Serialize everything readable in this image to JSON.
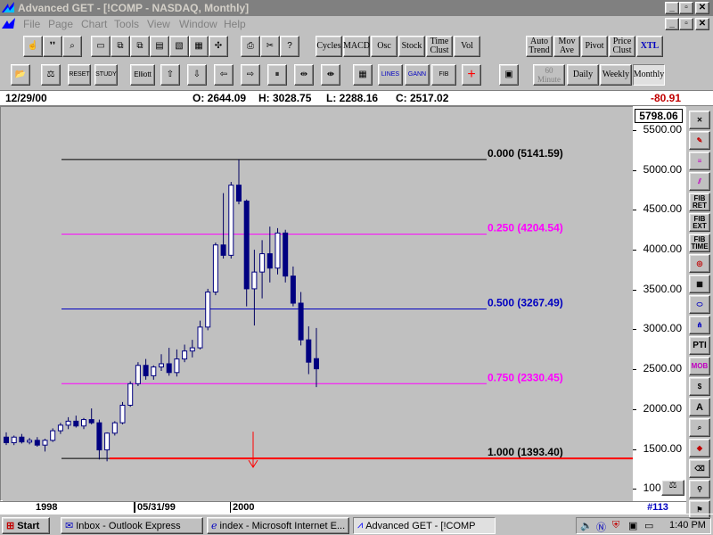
{
  "window": {
    "title": "Advanced GET - [!COMP   - NASDAQ, Monthly]",
    "controls": [
      "_",
      "▫",
      "✕"
    ],
    "child_controls": [
      "_",
      "▫",
      "✕"
    ]
  },
  "menu": [
    "File",
    "Page",
    "Chart",
    "Tools",
    "View",
    "Window",
    "Help"
  ],
  "toolbar1": {
    "text_buttons": [
      "Cycles",
      "MACD",
      "Osc",
      "Stock",
      "Time Clust",
      "Vol"
    ],
    "right_buttons": [
      "Auto Trend",
      "Mov Ave",
      "Pivot",
      "Price Clust",
      "XTL"
    ]
  },
  "toolbar2": {
    "labeled_buttons": [
      "RESET",
      "STUDY",
      "Elliott",
      "LINES",
      "GANN",
      "FIB"
    ],
    "timeframes": [
      "60 Minute",
      "Daily",
      "Weekly",
      "Monthly"
    ],
    "active_timeframe": "Monthly"
  },
  "info": {
    "date": "12/29/00",
    "open": "O: 2644.09",
    "high": "H: 3028.75",
    "low": "L: 2288.16",
    "close": "C: 2517.02",
    "change": "-80.91"
  },
  "current_price": "5798.06",
  "price_axis": [
    "5500.00",
    "5000.00",
    "4500.00",
    "4000.00",
    "3500.00",
    "3000.00",
    "2500.00",
    "2000.00",
    "1500.00",
    "1000.00"
  ],
  "date_axis": [
    "1998",
    "05/31/99",
    "2000"
  ],
  "chart_data": {
    "type": "candlestick",
    "ylim": [
      880,
      5800
    ],
    "fib_levels": [
      {
        "ratio": "0.000",
        "price": "5141.59",
        "label": "0.000 (5141.59)",
        "color": "#000000"
      },
      {
        "ratio": "0.250",
        "price": "4204.54",
        "label": "0.250 (4204.54)",
        "color": "#ff00ff"
      },
      {
        "ratio": "0.500",
        "price": "3267.49",
        "label": "0.500 (3267.49)",
        "color": "#0000c0"
      },
      {
        "ratio": "0.750",
        "price": "2330.45",
        "label": "0.750 (2330.45)",
        "color": "#ff00ff"
      },
      {
        "ratio": "1.000",
        "price": "1393.40",
        "label": "1.000 (1393.40)",
        "color": "#000000"
      }
    ],
    "support_line": 1393.4,
    "candles": [
      {
        "o": 1660,
        "h": 1720,
        "l": 1560,
        "c": 1590
      },
      {
        "o": 1590,
        "h": 1680,
        "l": 1560,
        "c": 1660
      },
      {
        "o": 1660,
        "h": 1700,
        "l": 1580,
        "c": 1600
      },
      {
        "o": 1600,
        "h": 1650,
        "l": 1570,
        "c": 1620
      },
      {
        "o": 1620,
        "h": 1660,
        "l": 1540,
        "c": 1560
      },
      {
        "o": 1560,
        "h": 1640,
        "l": 1480,
        "c": 1620
      },
      {
        "o": 1620,
        "h": 1770,
        "l": 1600,
        "c": 1740
      },
      {
        "o": 1740,
        "h": 1840,
        "l": 1700,
        "c": 1810
      },
      {
        "o": 1810,
        "h": 1910,
        "l": 1760,
        "c": 1860
      },
      {
        "o": 1860,
        "h": 1930,
        "l": 1780,
        "c": 1800
      },
      {
        "o": 1800,
        "h": 1900,
        "l": 1760,
        "c": 1880
      },
      {
        "o": 1880,
        "h": 2020,
        "l": 1820,
        "c": 1840
      },
      {
        "o": 1840,
        "h": 1880,
        "l": 1380,
        "c": 1500
      },
      {
        "o": 1500,
        "h": 1720,
        "l": 1357,
        "c": 1710
      },
      {
        "o": 1710,
        "h": 1860,
        "l": 1680,
        "c": 1840
      },
      {
        "o": 1840,
        "h": 2100,
        "l": 1820,
        "c": 2060
      },
      {
        "o": 2060,
        "h": 2360,
        "l": 2040,
        "c": 2330
      },
      {
        "o": 2330,
        "h": 2600,
        "l": 2300,
        "c": 2560
      },
      {
        "o": 2560,
        "h": 2640,
        "l": 2380,
        "c": 2430
      },
      {
        "o": 2430,
        "h": 2560,
        "l": 2380,
        "c": 2540
      },
      {
        "o": 2540,
        "h": 2700,
        "l": 2490,
        "c": 2580
      },
      {
        "o": 2580,
        "h": 2780,
        "l": 2430,
        "c": 2470
      },
      {
        "o": 2470,
        "h": 2760,
        "l": 2420,
        "c": 2640
      },
      {
        "o": 2640,
        "h": 2820,
        "l": 2600,
        "c": 2740
      },
      {
        "o": 2740,
        "h": 2880,
        "l": 2660,
        "c": 2780
      },
      {
        "o": 2780,
        "h": 3120,
        "l": 2760,
        "c": 3040
      },
      {
        "o": 3040,
        "h": 3520,
        "l": 3000,
        "c": 3480
      },
      {
        "o": 3480,
        "h": 4100,
        "l": 3440,
        "c": 4070
      },
      {
        "o": 4070,
        "h": 4720,
        "l": 3900,
        "c": 3940
      },
      {
        "o": 3940,
        "h": 4860,
        "l": 3900,
        "c": 4820
      },
      {
        "o": 4820,
        "h": 5141,
        "l": 4580,
        "c": 4620
      },
      {
        "o": 4620,
        "h": 4640,
        "l": 3300,
        "c": 3520
      },
      {
        "o": 3520,
        "h": 4010,
        "l": 3060,
        "c": 3730
      },
      {
        "o": 3730,
        "h": 4130,
        "l": 3400,
        "c": 3960
      },
      {
        "o": 3960,
        "h": 4300,
        "l": 3600,
        "c": 3780
      },
      {
        "o": 3780,
        "h": 4280,
        "l": 3700,
        "c": 4220
      },
      {
        "o": 4220,
        "h": 4260,
        "l": 3600,
        "c": 3680
      },
      {
        "o": 3680,
        "h": 3800,
        "l": 3300,
        "c": 3340
      },
      {
        "o": 3340,
        "h": 3480,
        "l": 2810,
        "c": 2880
      },
      {
        "o": 2880,
        "h": 3050,
        "l": 2450,
        "c": 2600
      },
      {
        "o": 2644,
        "h": 3029,
        "l": 2288,
        "c": 2517
      }
    ]
  },
  "right_toolbar": [
    "FIB RET",
    "FIB EXT",
    "FIB TIME",
    "PTI",
    "MOB",
    "A"
  ],
  "bottom_counter": "#113",
  "taskbar": {
    "start": "Start",
    "tasks": [
      "Inbox - Outlook Express",
      "index - Microsoft Internet E...",
      "Advanced GET - [!COMP"
    ],
    "clock": "1:40 PM"
  }
}
